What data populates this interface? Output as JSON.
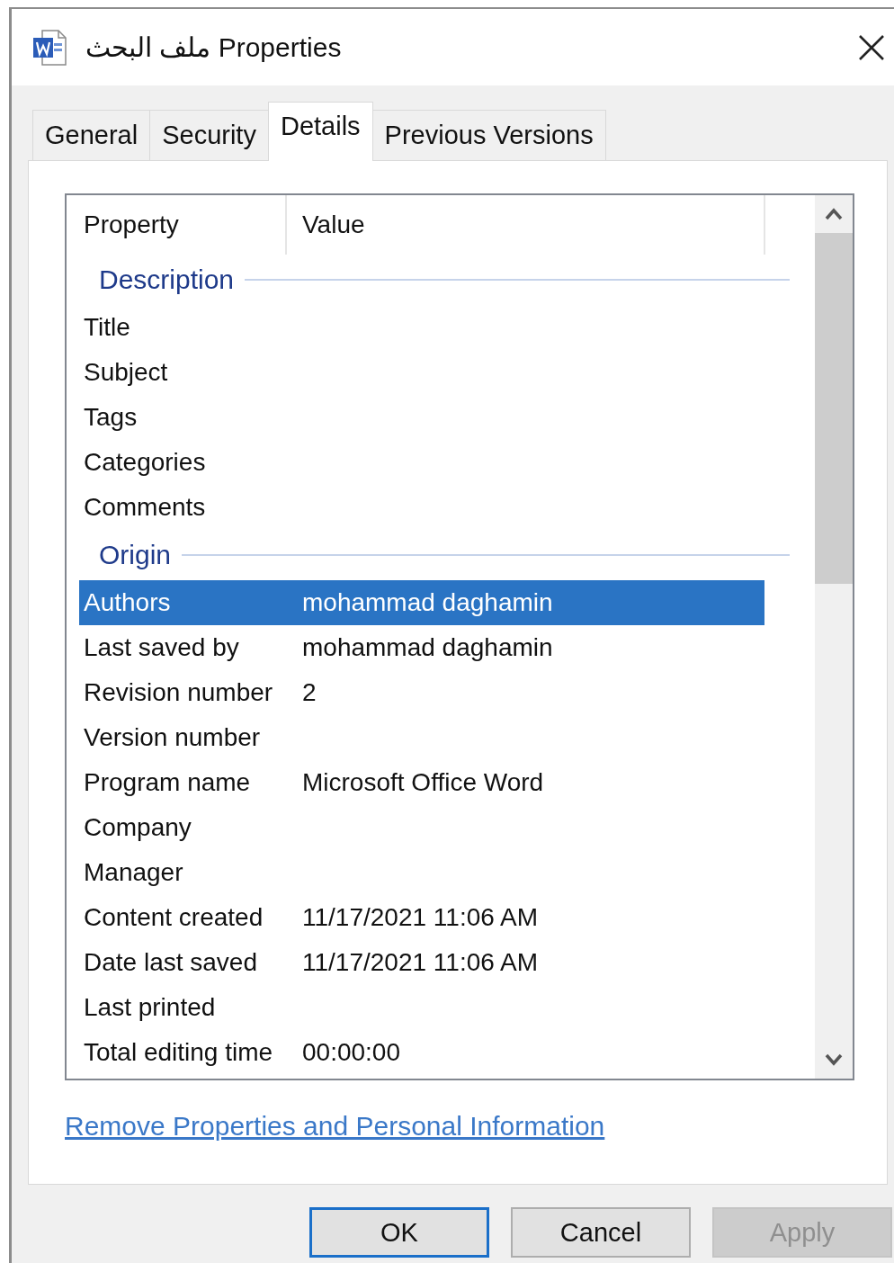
{
  "window": {
    "title": "ملف البحث Properties"
  },
  "tabs": [
    {
      "label": "General",
      "selected": false
    },
    {
      "label": "Security",
      "selected": false
    },
    {
      "label": "Details",
      "selected": true
    },
    {
      "label": "Previous Versions",
      "selected": false
    }
  ],
  "list": {
    "columns": [
      "Property",
      "Value"
    ],
    "groups": [
      {
        "title": "Description",
        "rows": [
          {
            "property": "Title",
            "selected": false
          },
          {
            "property": "Subject",
            "selected": false
          },
          {
            "property": "Tags",
            "selected": false
          },
          {
            "property": "Categories",
            "selected": false
          },
          {
            "property": "Comments",
            "selected": false
          }
        ]
      },
      {
        "title": "Origin",
        "rows": [
          {
            "property": "Authors",
            "value": "mohammad daghamin",
            "selected": true
          },
          {
            "property": "Last saved by",
            "value": "mohammad daghamin",
            "selected": false
          },
          {
            "property": "Revision number",
            "value": "2",
            "selected": false
          },
          {
            "property": "Version number",
            "selected": false
          },
          {
            "property": "Program name",
            "value": "Microsoft Office Word",
            "selected": false
          },
          {
            "property": "Company",
            "selected": false
          },
          {
            "property": "Manager",
            "selected": false
          },
          {
            "property": "Content created",
            "value": "11/17/2021 11:06 AM",
            "selected": false
          },
          {
            "property": "Date last saved",
            "value": "11/17/2021 11:06 AM",
            "selected": false
          },
          {
            "property": "Last printed",
            "selected": false
          },
          {
            "property": "Total editing time",
            "value": "00:00:00",
            "selected": false
          }
        ]
      }
    ]
  },
  "link": "Remove Properties and Personal Information",
  "buttons": [
    {
      "label": "OK",
      "default": true,
      "disabled": false
    },
    {
      "label": "Cancel",
      "default": false,
      "disabled": false
    },
    {
      "label": "Apply",
      "default": false,
      "disabled": true
    }
  ]
}
